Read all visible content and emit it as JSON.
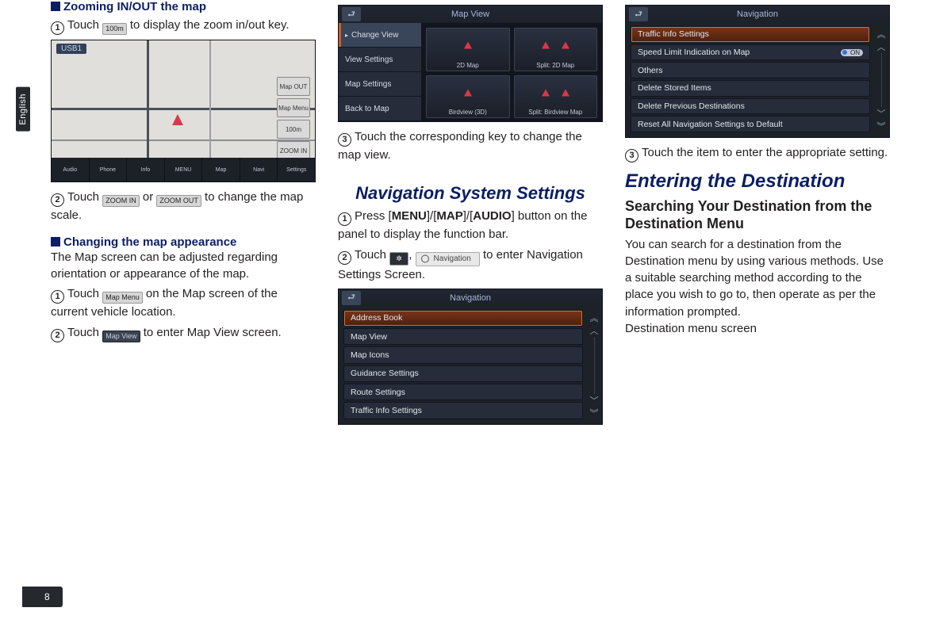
{
  "side_tab": "English",
  "page_number": "8",
  "col1": {
    "h_zoom": "Zooming IN/OUT the map",
    "step1_a": "Touch ",
    "zoom_chip": "100m",
    "step1_b": " to display the zoom in/out key.",
    "shot1": {
      "tag": "USB1",
      "side": [
        "Map OUT",
        "Map Menu",
        "100m",
        "ZOOM IN"
      ],
      "bar": [
        "Audio",
        "Phone",
        "Info",
        "MENU",
        "Map",
        "Navi",
        "Settings"
      ]
    },
    "step2_a": "Touch ",
    "zin": "ZOOM IN",
    "ortxt": " or ",
    "zout": "ZOOM OUT",
    "step2_b": " to change the map scale.",
    "h_appear": "Changing the map appearance",
    "appear_body": "The Map screen can be adjusted regarding orientation or appearance of the map.",
    "stepA1_a": "Touch ",
    "mapmenu": "Map Menu",
    "stepA1_b": " on the Map screen of the current vehicle location.",
    "stepA2_a": "Touch ",
    "mapview": "Map View",
    "stepA2_b": " to enter Map View screen."
  },
  "col2": {
    "shot2": {
      "title": "Map View",
      "menu": [
        "Change View",
        "View Settings",
        "Map Settings",
        "Back to Map"
      ],
      "cells": [
        "2D Map",
        "Split: 2D Map",
        "Birdview (3D)",
        "Split: Birdview Map"
      ]
    },
    "step3": "Touch the corresponding key to change the map view.",
    "sec": "Navigation System Settings",
    "s1_a": "Press [",
    "s1_menu": "MENU",
    "s1_sep1": "]/[",
    "s1_map": "MAP",
    "s1_sep2": "]/[",
    "s1_audio": "AUDIO",
    "s1_b": "] button on the panel to display the function bar.",
    "s2_a": "Touch ",
    "gear": "⚙",
    "comma": ", ",
    "navchip": "Navigation",
    "s2_b": " to enter Navigation Settings Screen.",
    "shot3": {
      "title": "Navigation",
      "items": [
        "Address Book",
        "Map View",
        "Map Icons",
        "Guidance Settings",
        "Route Settings",
        "Traffic Info Settings"
      ]
    }
  },
  "col3": {
    "shot4": {
      "title": "Navigation",
      "items": [
        {
          "label": "Traffic Info Settings",
          "sel": true
        },
        {
          "label": "Speed Limit Indication on Map",
          "pill": "ON"
        },
        {
          "label": "Others"
        },
        {
          "label": "Delete Stored Items"
        },
        {
          "label": "Delete Previous Destinations"
        },
        {
          "label": "Reset All Navigation Settings to Default"
        }
      ]
    },
    "step3": "Touch the item to enter the appropriate setting.",
    "sec": "Entering the Destination",
    "sub": "Searching Your Destination from the Destination Menu",
    "body": "You can search for a destination from the Destination menu by using various methods. Use a suitable searching method according to the place you wish to go to, then operate as per the information prompted.",
    "tail": "Destination menu screen"
  }
}
